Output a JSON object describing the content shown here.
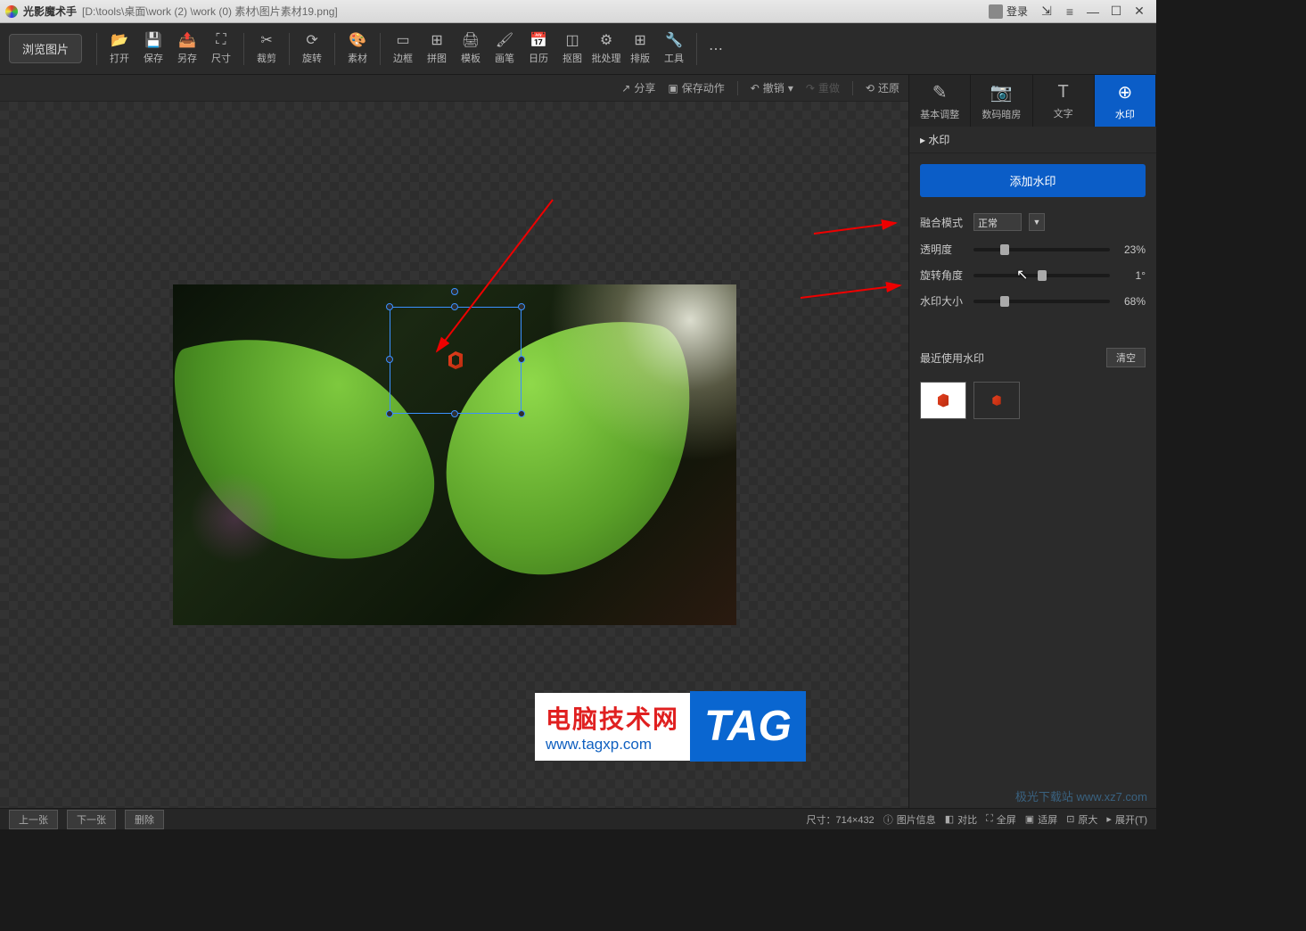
{
  "titlebar": {
    "app_name": "光影魔术手",
    "file_path": "[D:\\tools\\桌面\\work (2) \\work (0) 素材\\图片素材19.png]",
    "login": "登录"
  },
  "toolbar": {
    "browse": "浏览图片",
    "items": [
      {
        "icon": "📂",
        "label": "打开",
        "name": "open"
      },
      {
        "icon": "💾",
        "label": "保存",
        "name": "save"
      },
      {
        "icon": "📤",
        "label": "另存",
        "name": "save-as"
      },
      {
        "icon": "⛶",
        "label": "尺寸",
        "name": "size"
      },
      {
        "icon": "✂",
        "label": "裁剪",
        "name": "crop"
      },
      {
        "icon": "⟳",
        "label": "旋转",
        "name": "rotate"
      },
      {
        "icon": "🎨",
        "label": "素材",
        "name": "material"
      },
      {
        "icon": "▭",
        "label": "边框",
        "name": "border"
      },
      {
        "icon": "⊞",
        "label": "拼图",
        "name": "collage"
      },
      {
        "icon": "🖨",
        "label": "模板",
        "name": "template"
      },
      {
        "icon": "🖌",
        "label": "画笔",
        "name": "brush"
      },
      {
        "icon": "📅",
        "label": "日历",
        "name": "calendar"
      },
      {
        "icon": "◫",
        "label": "抠图",
        "name": "cutout"
      },
      {
        "icon": "⚙",
        "label": "批处理",
        "name": "batch"
      },
      {
        "icon": "⊞",
        "label": "排版",
        "name": "layout"
      },
      {
        "icon": "🔧",
        "label": "工具",
        "name": "tools"
      }
    ]
  },
  "actionbar": {
    "share": "分享",
    "save_action": "保存动作",
    "undo": "撤销",
    "redo": "重做",
    "restore": "还原"
  },
  "right_tabs": [
    {
      "icon": "✎",
      "label": "基本调整",
      "name": "basic-adjust"
    },
    {
      "icon": "📷",
      "label": "数码暗房",
      "name": "darkroom"
    },
    {
      "icon": "T",
      "label": "文字",
      "name": "text"
    },
    {
      "icon": "⊕",
      "label": "水印",
      "name": "watermark",
      "active": true
    }
  ],
  "panel": {
    "header": "水印",
    "add_button": "添加水印",
    "blend_mode": {
      "label": "融合模式",
      "value": "正常"
    },
    "opacity": {
      "label": "透明度",
      "value": "23%",
      "pct": 23
    },
    "rotation": {
      "label": "旋转角度",
      "value": "1°",
      "pct": 50
    },
    "size": {
      "label": "水印大小",
      "value": "68%",
      "pct": 23
    },
    "recent_label": "最近使用水印",
    "clear": "清空"
  },
  "statusbar": {
    "prev": "上一张",
    "next": "下一张",
    "delete": "删除",
    "dims_label": "尺寸：",
    "dims": "714×432",
    "info": "图片信息",
    "compare": "对比",
    "fullscreen": "全屏",
    "fitscreen": "适屏",
    "original": "原大",
    "expand": "展开(T)"
  },
  "overlay": {
    "line1": "电脑技术网",
    "line2": "www.tagxp.com",
    "tag": "TAG",
    "xz7": "极光下载站 www.xz7.com"
  }
}
